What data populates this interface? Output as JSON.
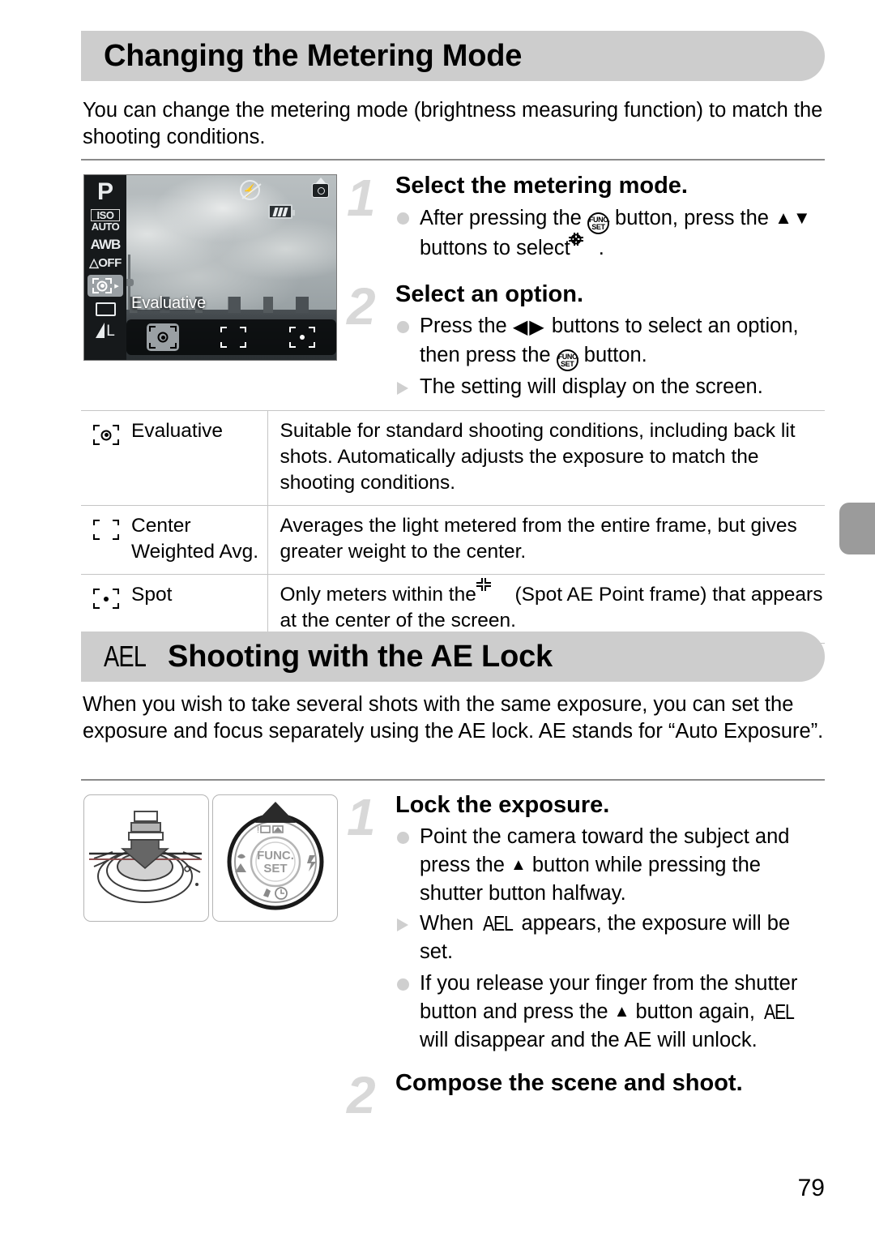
{
  "page": {
    "number": "79"
  },
  "section1": {
    "title": "Changing the Metering Mode",
    "intro": "You can change the metering mode (brightness measuring function) to match the shooting conditions.",
    "lcd": {
      "mode": "P",
      "iso_label": "ISO",
      "iso_value": "AUTO",
      "white_balance": "AWB",
      "my_colors": "OFF",
      "selected_option_label": "Evaluative",
      "options": [
        "evaluative-metering-icon",
        "center-weighted-metering-icon",
        "spot-metering-icon"
      ],
      "icons": [
        "flash-off-icon",
        "battery-icon",
        "camera-shake-icon",
        "image-quality-icon"
      ]
    },
    "steps": [
      {
        "number": "1",
        "heading": "Select the metering mode.",
        "bullets": [
          {
            "kind": "dot",
            "parts": [
              {
                "t": "text",
                "v": "After pressing the "
              },
              {
                "t": "icon",
                "v": "func-set"
              },
              {
                "t": "text",
                "v": " button, press the "
              },
              {
                "t": "icon",
                "v": "up-down"
              },
              {
                "t": "text",
                "v": " buttons to select "
              },
              {
                "t": "icon",
                "v": "metering"
              },
              {
                "t": "text",
                "v": "."
              }
            ]
          }
        ]
      },
      {
        "number": "2",
        "heading": "Select an option.",
        "bullets": [
          {
            "kind": "dot",
            "parts": [
              {
                "t": "text",
                "v": "Press the "
              },
              {
                "t": "icon",
                "v": "left-right"
              },
              {
                "t": "text",
                "v": " buttons to select an option, then press the "
              },
              {
                "t": "icon",
                "v": "func-set"
              },
              {
                "t": "text",
                "v": " button."
              }
            ]
          },
          {
            "kind": "tri",
            "parts": [
              {
                "t": "text",
                "v": "The setting will display on the screen."
              }
            ]
          }
        ]
      }
    ],
    "table": {
      "rows": [
        {
          "icon": "evaluative-metering-icon",
          "name": "Evaluative",
          "desc": "Suitable for standard shooting conditions, including back lit shots. Automatically adjusts the exposure to match the shooting conditions."
        },
        {
          "icon": "center-weighted-metering-icon",
          "name": "Center\nWeighted Avg.",
          "desc": "Averages the light metered from the entire frame, but gives greater weight to the center."
        },
        {
          "icon": "spot-metering-icon",
          "name": "Spot",
          "desc_before": "Only meters within the ",
          "desc_after": " (Spot AE Point frame) that appears at the center of the screen."
        }
      ]
    }
  },
  "section2": {
    "badge": "AEL",
    "title": "Shooting with the AE Lock",
    "intro": "When you wish to take several shots with the same exposure, you can set the exposure and focus separately using the AE lock. AE stands for “Auto Exposure”.",
    "diagrams": [
      {
        "name": "shutter-button-halfpress-diagram"
      },
      {
        "name": "control-dial-diagram",
        "center_top": "FUNC.",
        "center_bottom": "SET"
      }
    ],
    "steps": [
      {
        "number": "1",
        "heading": "Lock the exposure.",
        "bullets": [
          {
            "kind": "dot",
            "parts": [
              {
                "t": "text",
                "v": "Point the camera toward the subject and press the "
              },
              {
                "t": "icon",
                "v": "up-arrow"
              },
              {
                "t": "text",
                "v": " button while pressing the shutter button halfway."
              }
            ]
          },
          {
            "kind": "tri",
            "parts": [
              {
                "t": "text",
                "v": "When "
              },
              {
                "t": "icon",
                "v": "ael"
              },
              {
                "t": "text",
                "v": " appears, the exposure will be set."
              }
            ]
          },
          {
            "kind": "dot",
            "parts": [
              {
                "t": "text",
                "v": "If you release your finger from the shutter button and press the "
              },
              {
                "t": "icon",
                "v": "up-arrow"
              },
              {
                "t": "text",
                "v": " button again, "
              },
              {
                "t": "icon",
                "v": "ael"
              },
              {
                "t": "text",
                "v": " will disappear and the AE will unlock."
              }
            ]
          }
        ]
      },
      {
        "number": "2",
        "heading": "Compose the scene and shoot.",
        "bullets": []
      }
    ]
  }
}
